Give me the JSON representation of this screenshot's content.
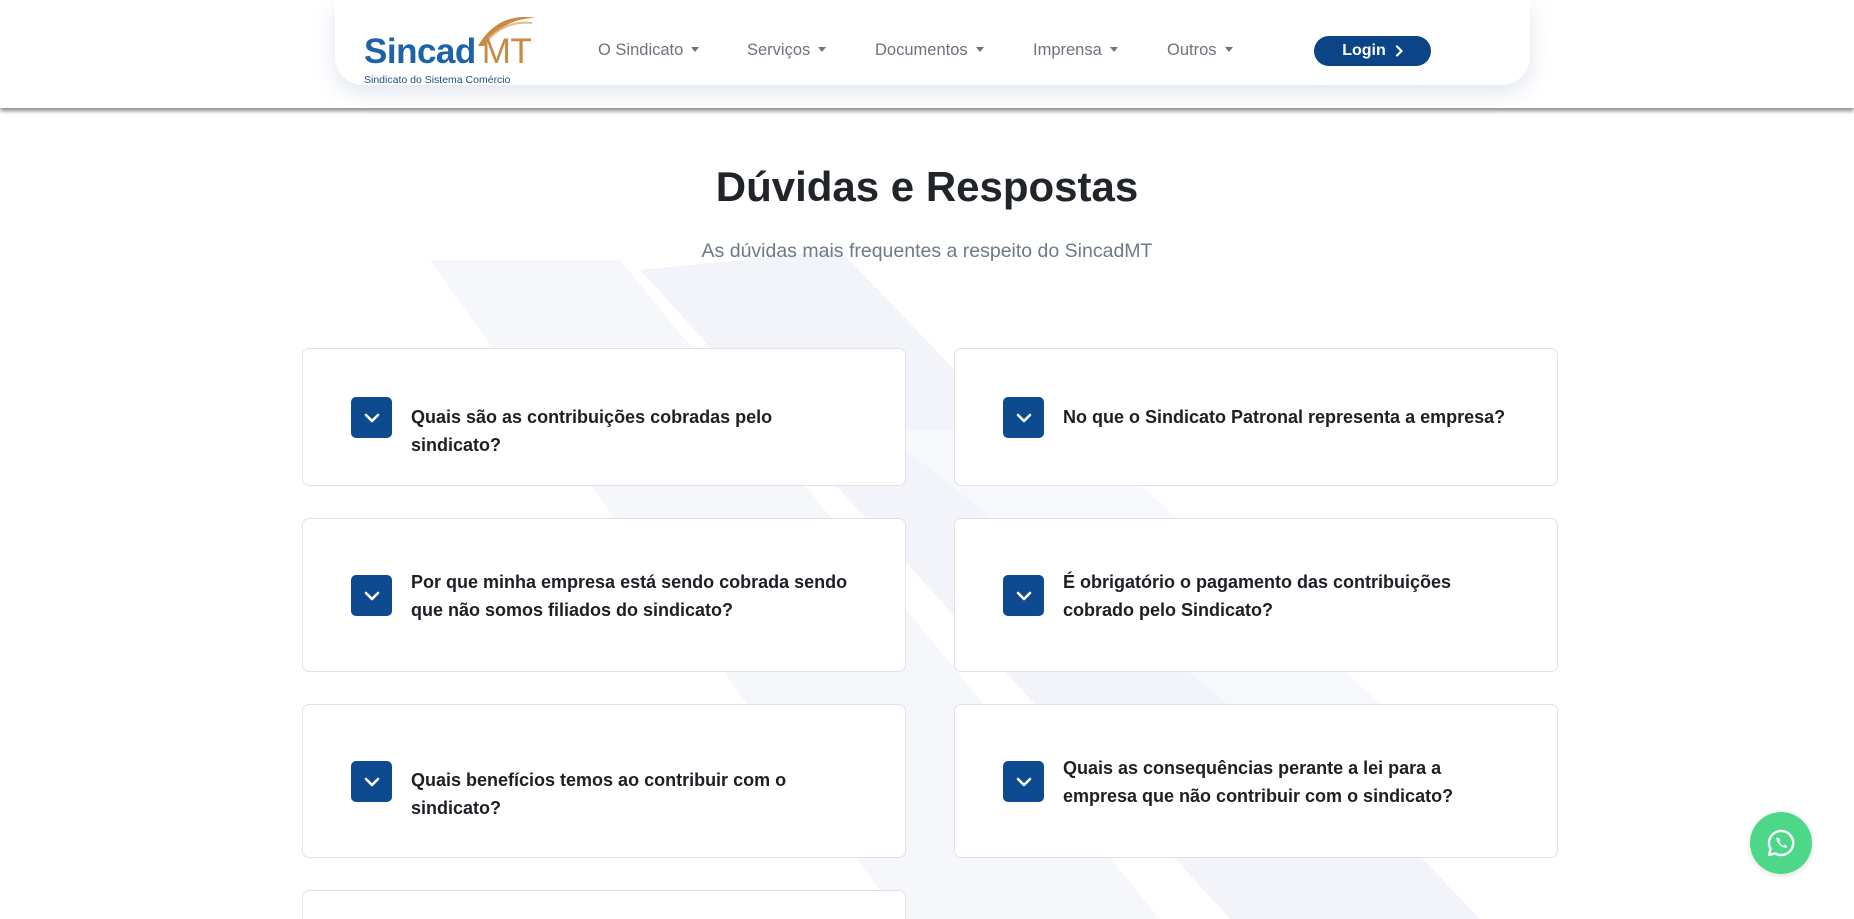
{
  "brand": {
    "name_primary": "Sincad",
    "name_secondary": "MT",
    "tagline": "Sindicato do Sistema Comércio",
    "colors": {
      "primary": "#0b4588",
      "accent": "#c98a45",
      "whatsapp": "#4cd888"
    }
  },
  "nav": {
    "items": [
      {
        "label": "O Sindicato"
      },
      {
        "label": "Serviços"
      },
      {
        "label": "Documentos"
      },
      {
        "label": "Imprensa"
      },
      {
        "label": "Outros"
      }
    ],
    "login_label": "Login"
  },
  "faq": {
    "title": "Dúvidas e Respostas",
    "subtitle": "As dúvidas mais frequentes a respeito do SincadMT",
    "questions": [
      {
        "text": "Quais são as contribuições cobradas pelo sindicato?"
      },
      {
        "text": "No que o Sindicato Patronal representa a empresa?"
      },
      {
        "text": "Por que minha empresa está sendo cobrada sendo que não somos filiados do sindicato?"
      },
      {
        "text": "É obrigatório o pagamento das contribuições cobrado pelo Sindicato?"
      },
      {
        "text": "Quais benefícios temos ao contribuir com o sindicato?"
      },
      {
        "text": "Quais as consequências perante a lei para a empresa que não contribuir com o sindicato?"
      }
    ]
  },
  "icons": {
    "toggle": "chevron-down-icon",
    "login_arrow": "chevron-right-icon",
    "floating": "whatsapp-icon"
  }
}
